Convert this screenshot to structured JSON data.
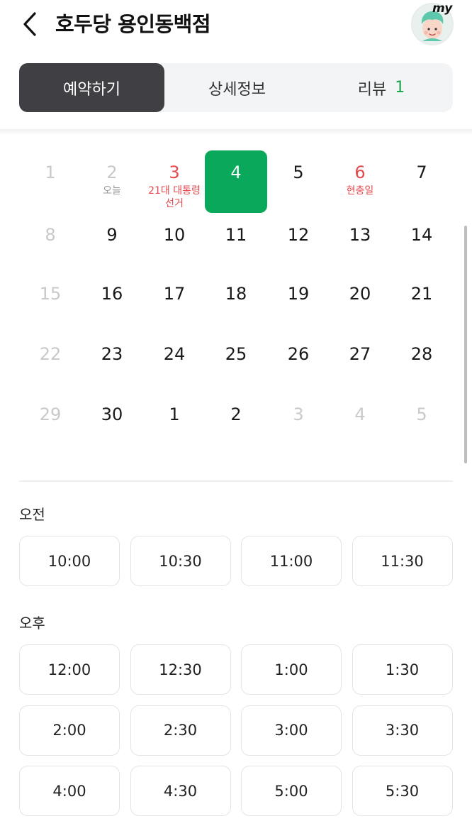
{
  "header": {
    "title": "호두당 용인동백점",
    "avatar_label": "my"
  },
  "tabs": [
    {
      "label": "예약하기",
      "active": true
    },
    {
      "label": "상세정보",
      "active": false
    },
    {
      "label": "리뷰",
      "count": "1",
      "active": false
    }
  ],
  "calendar": {
    "weeks": [
      [
        {
          "day": "1",
          "state": "muted"
        },
        {
          "day": "2",
          "state": "muted",
          "sub": "오늘"
        },
        {
          "day": "3",
          "state": "holiday",
          "sub": "21대 대통령 선거"
        },
        {
          "day": "4",
          "state": "selected"
        },
        {
          "day": "5",
          "state": "normal"
        },
        {
          "day": "6",
          "state": "holiday",
          "sub": "현충일"
        },
        {
          "day": "7",
          "state": "normal"
        }
      ],
      [
        {
          "day": "8",
          "state": "muted"
        },
        {
          "day": "9",
          "state": "normal"
        },
        {
          "day": "10",
          "state": "normal"
        },
        {
          "day": "11",
          "state": "normal"
        },
        {
          "day": "12",
          "state": "normal"
        },
        {
          "day": "13",
          "state": "normal"
        },
        {
          "day": "14",
          "state": "normal"
        }
      ],
      [
        {
          "day": "15",
          "state": "muted"
        },
        {
          "day": "16",
          "state": "normal"
        },
        {
          "day": "17",
          "state": "normal"
        },
        {
          "day": "18",
          "state": "normal"
        },
        {
          "day": "19",
          "state": "normal"
        },
        {
          "day": "20",
          "state": "normal"
        },
        {
          "day": "21",
          "state": "normal"
        }
      ],
      [
        {
          "day": "22",
          "state": "muted"
        },
        {
          "day": "23",
          "state": "normal"
        },
        {
          "day": "24",
          "state": "normal"
        },
        {
          "day": "25",
          "state": "normal"
        },
        {
          "day": "26",
          "state": "normal"
        },
        {
          "day": "27",
          "state": "normal"
        },
        {
          "day": "28",
          "state": "normal"
        }
      ],
      [
        {
          "day": "29",
          "state": "muted"
        },
        {
          "day": "30",
          "state": "normal"
        },
        {
          "day": "1",
          "state": "normal"
        },
        {
          "day": "2",
          "state": "normal"
        },
        {
          "day": "3",
          "state": "muted"
        },
        {
          "day": "4",
          "state": "muted"
        },
        {
          "day": "5",
          "state": "muted"
        }
      ]
    ]
  },
  "time_sections": [
    {
      "label": "오전",
      "slots": [
        "10:00",
        "10:30",
        "11:00",
        "11:30"
      ]
    },
    {
      "label": "오후",
      "slots": [
        "12:00",
        "12:30",
        "1:00",
        "1:30",
        "2:00",
        "2:30",
        "3:00",
        "3:30",
        "4:00",
        "4:30",
        "5:00",
        "5:30"
      ]
    }
  ],
  "colors": {
    "accent_green": "#0aa85a",
    "holiday_red": "#e5484d",
    "active_tab": "#3f3f44"
  }
}
